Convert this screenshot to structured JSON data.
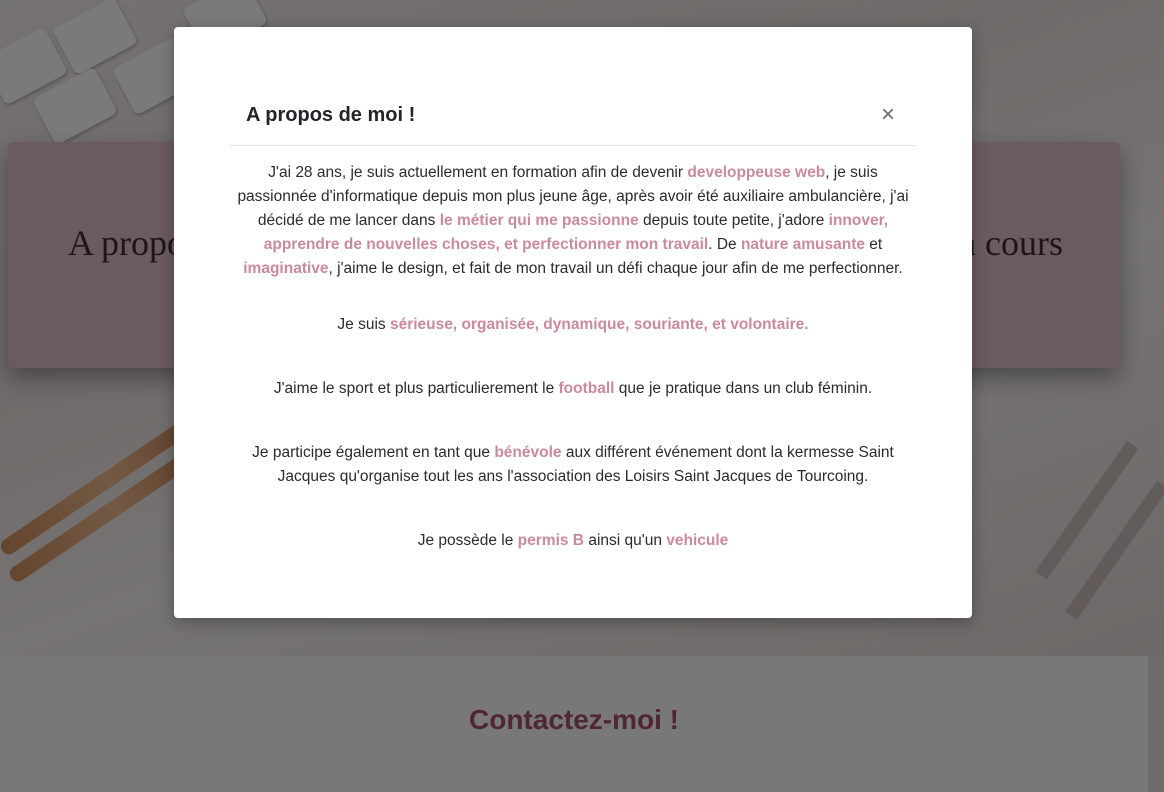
{
  "background": {
    "hero_title_left": "A propo",
    "hero_title_right": "n cours",
    "contact_title": "Contactez-moi !"
  },
  "modal": {
    "title": "A propos de moi !",
    "close_label": "×",
    "paragraphs": [
      {
        "segments": [
          {
            "text": "J'ai 28 ans, je suis actuellement en formation afin de devenir ",
            "bold": false
          },
          {
            "text": "developpeuse web",
            "bold": true
          },
          {
            "text": ", je suis passionnée d'informatique depuis mon plus jeune âge, après avoir été auxiliaire ambulancière, j'ai décidé de me lancer dans ",
            "bold": false
          },
          {
            "text": "le métier qui me passionne",
            "bold": true
          },
          {
            "text": " depuis toute petite, j'adore ",
            "bold": false
          },
          {
            "text": "innover, apprendre de nouvelles choses, et perfectionner mon travail",
            "bold": true
          },
          {
            "text": ". De ",
            "bold": false
          },
          {
            "text": "nature amusante",
            "bold": true
          },
          {
            "text": " et ",
            "bold": false
          },
          {
            "text": "imaginative",
            "bold": true
          },
          {
            "text": ", j'aime le design, et fait de mon travail un défi chaque jour afin de me perfectionner.",
            "bold": false
          }
        ]
      },
      {
        "segments": [
          {
            "text": "Je suis ",
            "bold": false
          },
          {
            "text": "sérieuse, organisée, dynamique, souriante, et volontaire.",
            "bold": true
          }
        ]
      },
      {
        "segments": [
          {
            "text": "J'aime le sport et plus particulierement le ",
            "bold": false
          },
          {
            "text": "football",
            "bold": true
          },
          {
            "text": " que je pratique dans un club féminin.",
            "bold": false
          }
        ]
      },
      {
        "segments": [
          {
            "text": "Je participe également en tant que ",
            "bold": false
          },
          {
            "text": "bénévole",
            "bold": true
          },
          {
            "text": " aux différent événement dont la kermesse Saint Jacques qu'organise tout les ans l'association des Loisirs Saint Jacques de Tourcoing.",
            "bold": false
          }
        ]
      },
      {
        "segments": [
          {
            "text": "Je possède le ",
            "bold": false
          },
          {
            "text": "permis B",
            "bold": true
          },
          {
            "text": " ainsi qu'un ",
            "bold": false
          },
          {
            "text": "vehicule",
            "bold": true
          }
        ]
      }
    ]
  },
  "colors": {
    "highlight": "#c98a9b",
    "contact_title": "#a14d67",
    "hero_card": "#d7b7bf"
  }
}
